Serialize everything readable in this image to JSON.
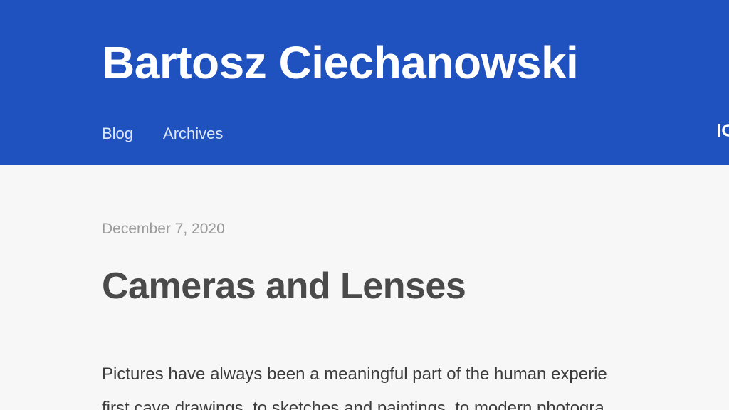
{
  "header": {
    "site_title": "Bartosz Ciechanowski",
    "nav": {
      "blog": "Blog",
      "archives": "Archives"
    },
    "accent_color": "#2052bf"
  },
  "post": {
    "date": "December 7, 2020",
    "title": "Cameras and Lenses",
    "intro_lines": [
      "Pictures have always been a meaningful part of the human experie",
      "first cave drawings, to sketches and paintings, to modern photogra"
    ]
  }
}
